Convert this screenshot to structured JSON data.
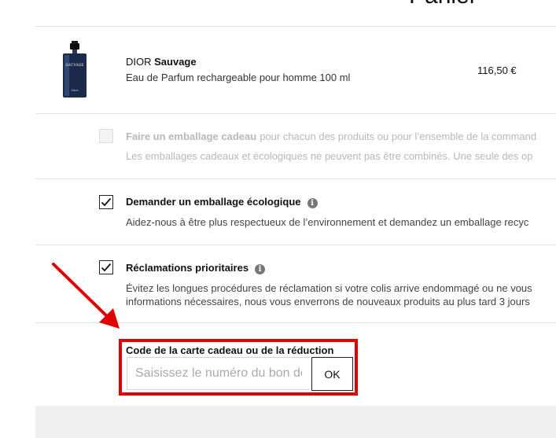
{
  "header": {
    "title": "Panier"
  },
  "product": {
    "brand": "DIOR",
    "name": "Sauvage",
    "description": "Eau de Parfum rechargeable pour homme 100 ml",
    "price": "116,50 €",
    "image_label": "SAUVAGE",
    "image_brand": "Dior"
  },
  "options": {
    "gift_wrap": {
      "title": "Faire un emballage cadeau",
      "title_suffix": "pour chacun des produits ou pour l’ensemble de la command",
      "text": "Les emballages cadeaux et écologiques ne peuvent pas être combinés. Une seule des op",
      "checked": false,
      "disabled": true
    },
    "eco_wrap": {
      "title": "Demander un emballage écologique",
      "text": "Aidez-nous à être plus respectueux de l’environnement et demandez un emballage recyc",
      "checked": true
    },
    "priority_claims": {
      "title": "Réclamations prioritaires",
      "text_line1": "Évitez les longues procédures de réclamation si votre colis arrive endommagé ou ne vous",
      "text_line2": "informations nécessaires, nous vous enverrons de nouveaux produits au plus tard 3 jours",
      "checked": true
    }
  },
  "coupon": {
    "label": "Code de la carte cadeau ou de la réduction",
    "placeholder": "Saisissez le numéro du bon de",
    "value": "",
    "button_label": "OK"
  },
  "colors": {
    "highlight": "#e00000",
    "text": "#111111",
    "disabled": "#b8b8b8"
  },
  "icons": {
    "checkmark": "check-icon",
    "info": "info-icon",
    "annotation": "arrow-icon"
  }
}
